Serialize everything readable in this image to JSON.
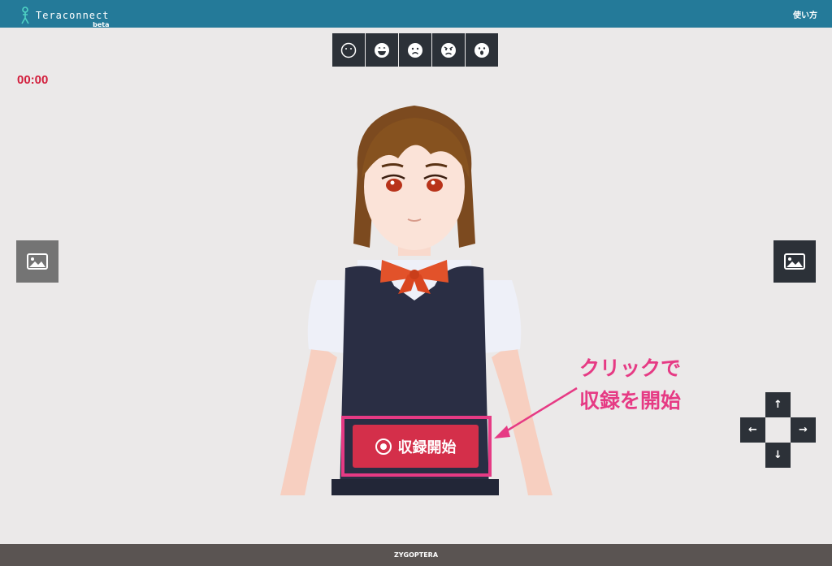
{
  "header": {
    "app_name": "Teraconnect",
    "beta_label": "beta",
    "help_link": "使い方",
    "color": "#247a99"
  },
  "emotion_toolbar": {
    "buttons": [
      {
        "icon": "neutral-face-icon"
      },
      {
        "icon": "happy-face-icon"
      },
      {
        "icon": "sad-face-icon"
      },
      {
        "icon": "angry-face-icon"
      },
      {
        "icon": "surprised-face-icon"
      }
    ]
  },
  "timer": {
    "value": "00:00",
    "color": "#d21e3c"
  },
  "side_buttons": {
    "left_icon": "image-icon",
    "right_icon": "image-icon"
  },
  "record": {
    "label": "収録開始",
    "color": "#d42f4a"
  },
  "annotation": {
    "line1": "クリックで",
    "line2": "収録を開始",
    "color": "#e63a84"
  },
  "dpad": {
    "up": "↑",
    "left": "←",
    "right": "→",
    "down": "↓"
  },
  "footer": {
    "text": "ZYGOPTERA"
  }
}
